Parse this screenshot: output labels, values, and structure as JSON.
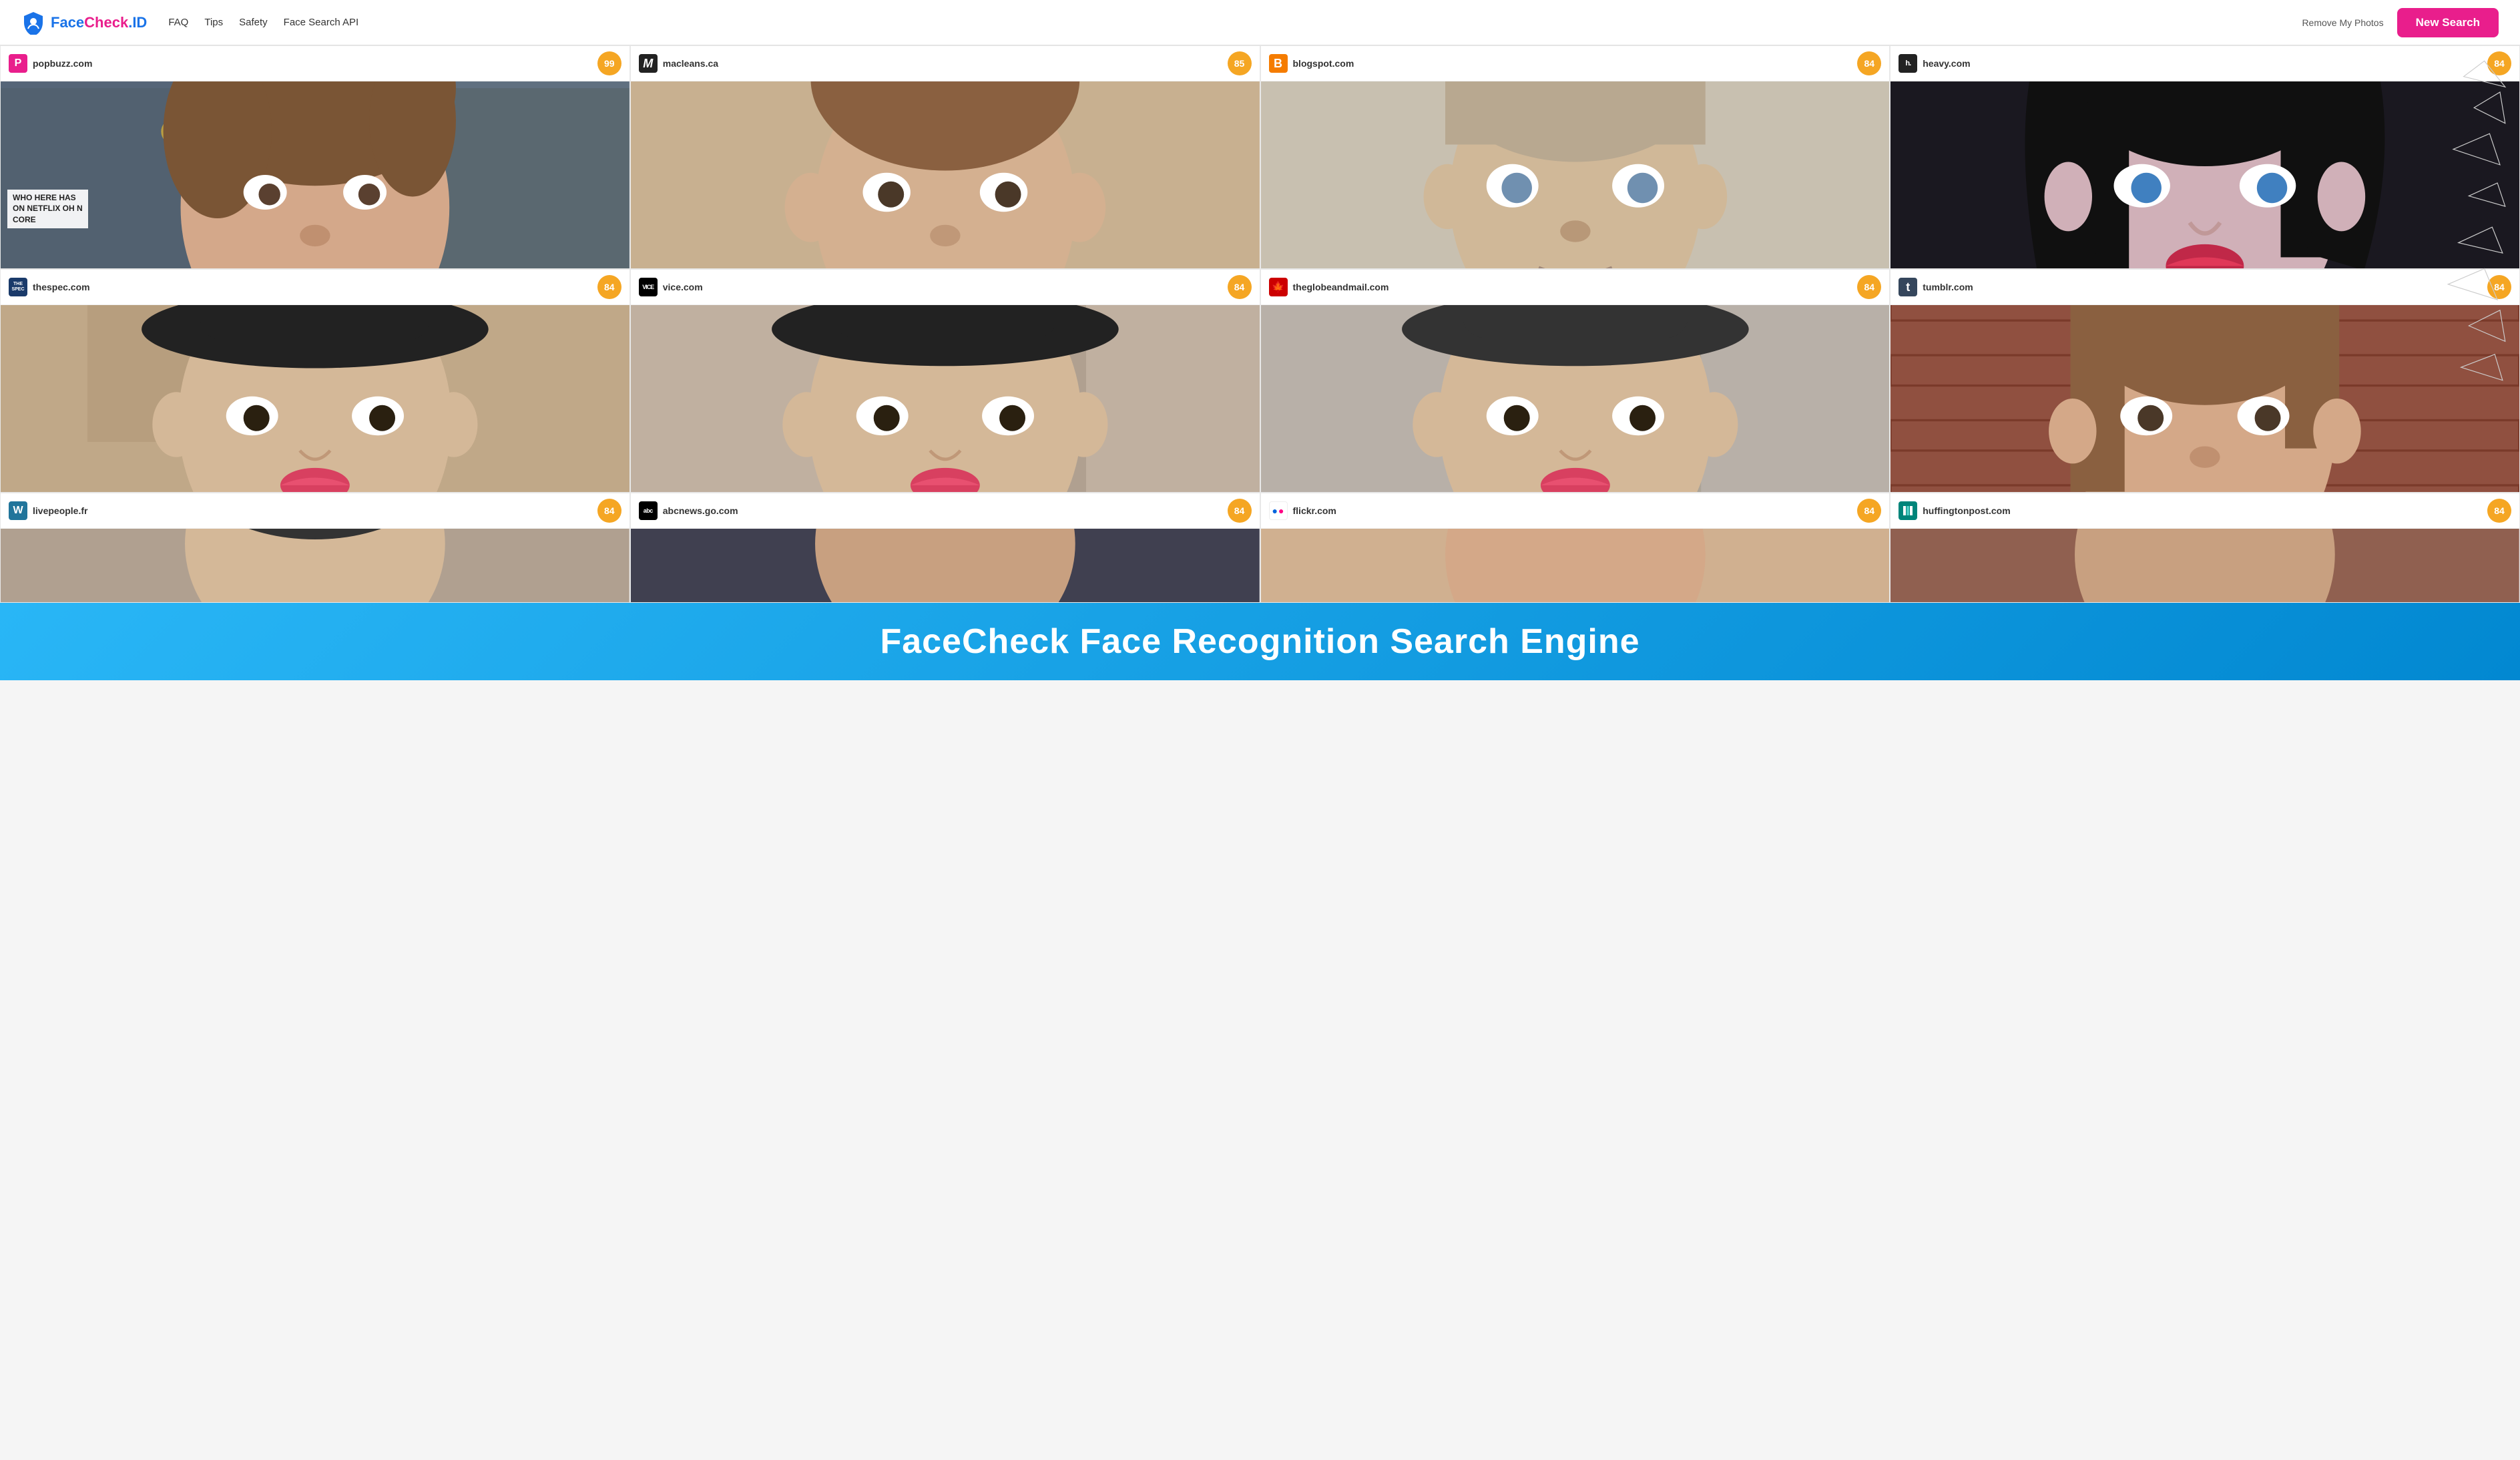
{
  "header": {
    "logo_text": "FaceCheck.ID",
    "logo_face": "Face",
    "logo_check": "Check",
    "logo_id": ".ID",
    "nav": [
      {
        "label": "FAQ",
        "href": "#"
      },
      {
        "label": "Tips",
        "href": "#"
      },
      {
        "label": "Safety",
        "href": "#"
      },
      {
        "label": "Face Search API",
        "href": "#"
      }
    ],
    "remove_photos_label": "Remove My Photos",
    "new_search_label": "New Search"
  },
  "results": [
    {
      "id": 1,
      "site": "popbuzz.com",
      "favicon_letter": "P",
      "favicon_class": "favicon-popbuzz",
      "score": "99",
      "card_class": "card-1",
      "has_overlay": true,
      "overlay_text": "WHO HERE HAS\nON NETFLIX OH N\nCORE"
    },
    {
      "id": 2,
      "site": "macleans.ca",
      "favicon_letter": "M",
      "favicon_class": "favicon-macleans",
      "score": "85",
      "card_class": "card-2",
      "has_overlay": false
    },
    {
      "id": 3,
      "site": "blogspot.com",
      "favicon_letter": "B",
      "favicon_class": "favicon-blogspot",
      "score": "84",
      "card_class": "card-3",
      "has_overlay": false
    },
    {
      "id": 4,
      "site": "heavy.com",
      "favicon_letter": "h.",
      "favicon_class": "favicon-heavy",
      "score": "84",
      "card_class": "card-4",
      "has_overlay": false
    },
    {
      "id": 5,
      "site": "thespec.com",
      "favicon_letter": "THE\nSPEC",
      "favicon_class": "favicon-thespec",
      "score": "84",
      "card_class": "card-5",
      "has_overlay": false
    },
    {
      "id": 6,
      "site": "vice.com",
      "favicon_letter": "VICE",
      "favicon_class": "favicon-vice",
      "score": "84",
      "card_class": "card-6",
      "has_overlay": false
    },
    {
      "id": 7,
      "site": "theglobeandmail.com",
      "favicon_letter": "🍁",
      "favicon_class": "favicon-globe",
      "score": "84",
      "card_class": "card-7",
      "has_overlay": false
    },
    {
      "id": 8,
      "site": "tumblr.com",
      "favicon_letter": "t",
      "favicon_class": "favicon-tumblr",
      "score": "84",
      "card_class": "card-8",
      "has_overlay": false
    },
    {
      "id": 9,
      "site": "livepeople.fr",
      "favicon_letter": "W",
      "favicon_class": "favicon-wordpress",
      "score": "84",
      "card_class": "card-9",
      "has_overlay": false,
      "partial": true
    },
    {
      "id": 10,
      "site": "abcnews.go.com",
      "favicon_letter": "abc",
      "favicon_class": "favicon-abc",
      "score": "84",
      "card_class": "card-10",
      "has_overlay": false,
      "partial": true
    },
    {
      "id": 11,
      "site": "flickr.com",
      "favicon_letter": "●●",
      "favicon_class": "favicon-flickr",
      "score": "84",
      "card_class": "card-11",
      "has_overlay": false,
      "partial": true
    },
    {
      "id": 12,
      "site": "huffingtonpost.com",
      "favicon_letter": "|||",
      "favicon_class": "favicon-huffpost",
      "score": "84",
      "card_class": "card-12",
      "has_overlay": false,
      "partial": true
    }
  ],
  "banner": {
    "text": "FaceCheck Face Recognition Search Engine"
  },
  "colors": {
    "accent_pink": "#e91e8c",
    "accent_blue": "#1a73e8",
    "score_orange": "#f5a623",
    "banner_blue": "#29b6f6"
  }
}
